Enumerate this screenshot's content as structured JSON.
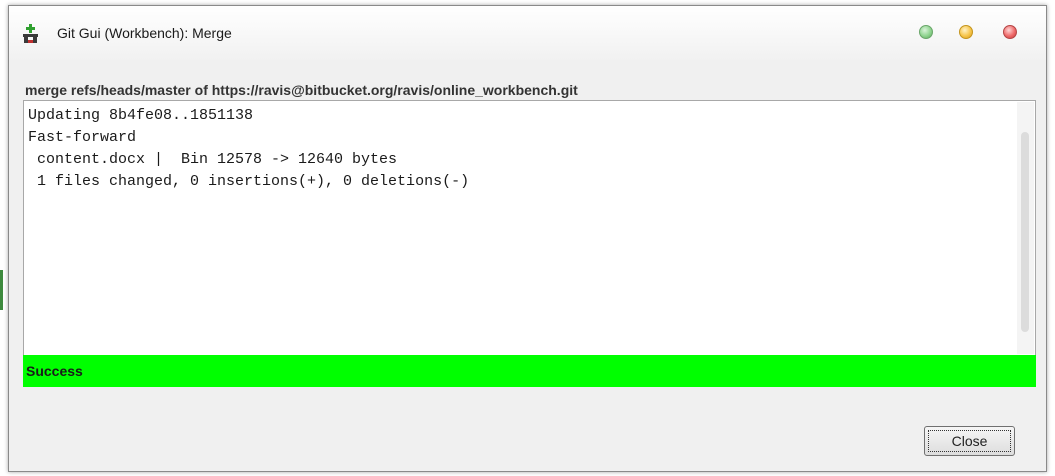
{
  "window": {
    "title": "Git Gui (Workbench): Merge",
    "app_icon": "git-gui-icon",
    "controls": [
      "minimize-icon",
      "maximize-icon",
      "close-icon"
    ]
  },
  "merge": {
    "label": "merge refs/heads/master of https://ravis@bitbucket.org/ravis/online_workbench.git"
  },
  "output": {
    "lines": [
      "Updating 8b4fe08..1851138",
      "Fast-forward",
      " content.docx |  Bin 12578 -> 12640 bytes",
      " 1 files changed, 0 insertions(+), 0 deletions(-)"
    ]
  },
  "status": {
    "text": "Success",
    "color": "#00ff00"
  },
  "buttons": {
    "close_label": "Close"
  }
}
